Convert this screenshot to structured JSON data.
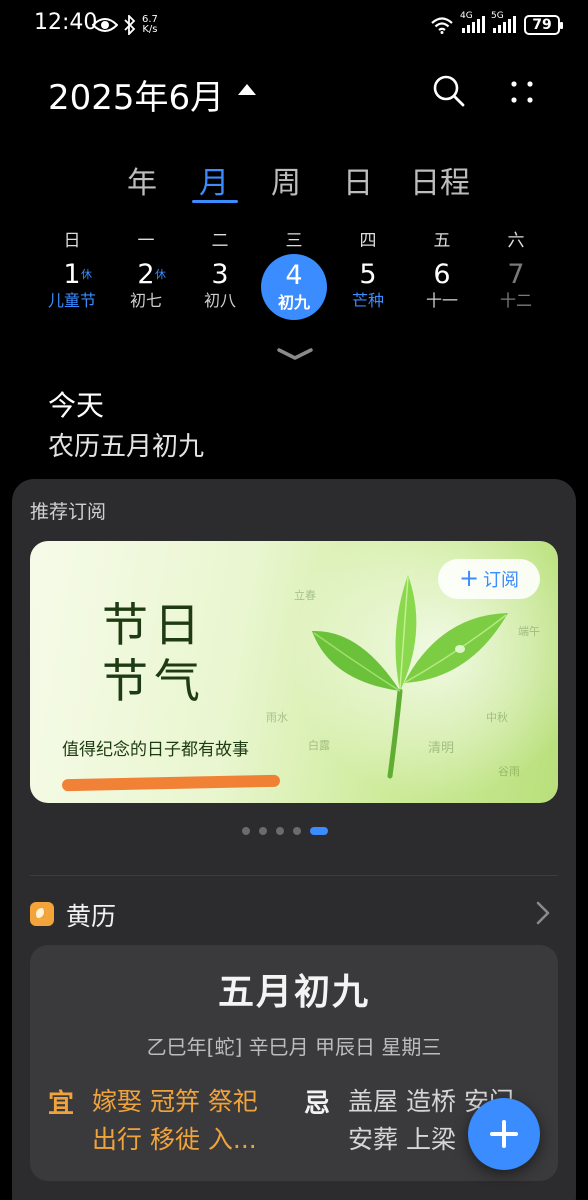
{
  "status_bar": {
    "time": "12:40",
    "net_speed_value": "6.7",
    "net_speed_unit": "K/s",
    "sim1_tag": "4G",
    "sim2_tag": "5G",
    "battery": "79",
    "icons": [
      "eye-icon",
      "bluetooth-icon",
      "wifi-icon",
      "signal-icon",
      "battery-icon"
    ]
  },
  "header": {
    "title": "2025年6月",
    "icons": [
      "caret-up-icon",
      "search-icon",
      "more-icon"
    ]
  },
  "tabs": [
    {
      "label": "年"
    },
    {
      "label": "月",
      "active": true
    },
    {
      "label": "周"
    },
    {
      "label": "日"
    },
    {
      "label": "日程"
    }
  ],
  "week": {
    "weekdays": [
      "日",
      "一",
      "二",
      "三",
      "四",
      "五",
      "六"
    ],
    "days": [
      {
        "num": "1",
        "lunar": "儿童节",
        "badge": "休"
      },
      {
        "num": "2",
        "lunar": "初七",
        "badge": "休"
      },
      {
        "num": "3",
        "lunar": "初八"
      },
      {
        "num": "4",
        "lunar": "初九",
        "selected": true
      },
      {
        "num": "5",
        "lunar": "芒种"
      },
      {
        "num": "6",
        "lunar": "十一"
      },
      {
        "num": "7",
        "lunar": "十二"
      }
    ]
  },
  "today": {
    "label": "今天",
    "lunar": "农历五月初九"
  },
  "recommend": {
    "title": "推荐订阅",
    "banner": {
      "title_line1": "节日",
      "title_line2": "节气",
      "subtitle": "值得纪念的日子都有故事",
      "subscribe_label": "订阅",
      "faint_terms": [
        "雨水",
        "白露",
        "清明",
        "谷雨",
        "中秋",
        "端午",
        "立春"
      ]
    },
    "pager": {
      "count": 5,
      "active": 4
    }
  },
  "almanac": {
    "title": "黄历",
    "date": "五月初九",
    "ganzhi": "乙巳年[蛇]  辛巳月 甲辰日 星期三",
    "yi_tag": "宜",
    "yi": "嫁娶 冠笄 祭祀 出行 移徙 入...",
    "ji_tag": "忌",
    "ji": "盖屋 造桥 安门 安葬 上梁"
  },
  "colors": {
    "accent": "#3a8cff",
    "almanac_yi": "#f0a23b",
    "panel": "#2c2c2e",
    "card": "#3a3a3c"
  }
}
